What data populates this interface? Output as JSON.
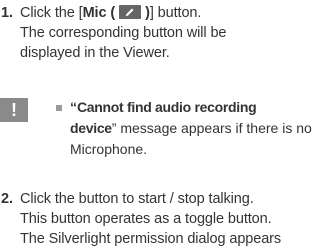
{
  "step1": {
    "number": "1.",
    "pre": "Click the [",
    "label": "Mic (",
    "post_paren": ")",
    "post": "] button.",
    "line2": "The corresponding button will be",
    "line3": "displayed in the Viewer.",
    "icon": "pencil-icon"
  },
  "note": {
    "icon_label": "!",
    "open_quote": "“",
    "bold1": "Cannot find audio recording",
    "bold2": "device",
    "line2_rest": "” message appears if there is no",
    "line3": "Microphone."
  },
  "step2": {
    "number": "2.",
    "line1": "Click the button to start / stop talking.",
    "line2": "This button operates as a toggle button.",
    "line3": "The Silverlight permission dialog appears"
  },
  "colors": {
    "text": "#333333",
    "icon_bg": "#666666",
    "note_icon": "#8a8a8a"
  }
}
